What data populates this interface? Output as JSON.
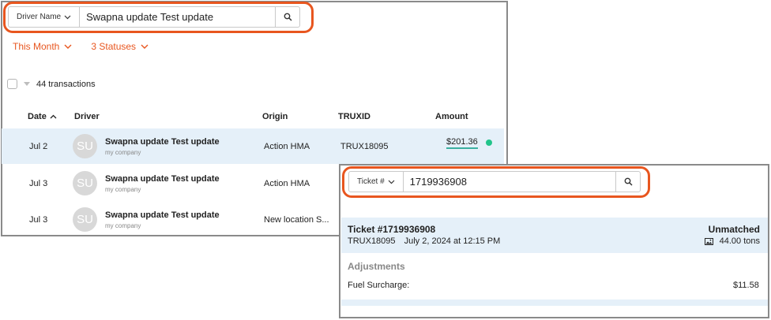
{
  "left_panel": {
    "search": {
      "filter_label": "Driver Name",
      "value": "Swapna update Test update"
    },
    "filters": [
      {
        "label": "This Month"
      },
      {
        "label": "3 Statuses"
      }
    ],
    "transactions_label": "44 transactions",
    "columns": {
      "date": "Date",
      "driver": "Driver",
      "origin": "Origin",
      "truxid": "TRUXID",
      "amount": "Amount"
    },
    "rows": [
      {
        "date": "Jul 2",
        "initials": "SU",
        "driver": "Swapna update Test update",
        "company": "my company",
        "origin": "Action HMA",
        "truxid": "TRUX18095",
        "amount": "$201.36"
      },
      {
        "date": "Jul 3",
        "initials": "SU",
        "driver": "Swapna update Test update",
        "company": "my company",
        "origin": "Action HMA"
      },
      {
        "date": "Jul 3",
        "initials": "SU",
        "driver": "Swapna update Test update",
        "company": "my company",
        "origin": "New location S..."
      }
    ]
  },
  "right_panel": {
    "search": {
      "filter_label": "Ticket #",
      "value": "1719936908"
    },
    "ticket": {
      "title": "Ticket #1719936908",
      "truxid": "TRUX18095",
      "datetime": "July 2, 2024 at 12:15 PM",
      "status": "Unmatched",
      "weight": "44.00 tons"
    },
    "adjustments_label": "Adjustments",
    "fuel_label": "Fuel Surcharge:",
    "fuel_value": "$11.58"
  },
  "colors": {
    "accent": "#e8561f",
    "row_highlight": "#e5f0f9",
    "status_dot": "#22c48a"
  }
}
